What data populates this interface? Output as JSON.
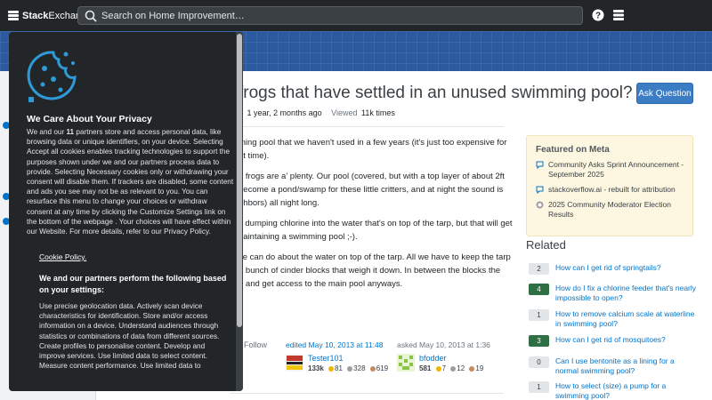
{
  "topbar": {
    "brand_a": "Stack",
    "brand_b": "Exchange",
    "search_placeholder": "Search on Home Improvement…",
    "icons": [
      "search-icon",
      "help-icon",
      "site-switcher-icon"
    ]
  },
  "question": {
    "title": "frogs that have settled in an unused swimming pool?",
    "ask_button": "Ask Question",
    "meta_partial": "d",
    "meta_modified": "1 year, 2 months ago",
    "meta_viewed_label": "Viewed",
    "meta_viewed": "11k times",
    "body": [
      [
        "ming pool that we haven't used in a few years (it's just too expensive for",
        "nt time)."
      ],
      [
        "e frogs are a' plenty. Our pool (covered, but with a top layer of about 2ft",
        "become a pond/swamp for these little critters, and at night the sound is",
        "ghbors) all night long."
      ],
      [
        "y dumping chlorine into the water that's on top of the tarp, but that will get",
        "naintaining a swimming pool ;-)."
      ],
      [
        "ve can do about the water on top of the tarp. All we have to keep the tarp",
        "a bunch of cinder blocks that weigh it down. In between the blocks the",
        "p and get access to the main pool anyways."
      ]
    ],
    "follow": "Follow",
    "edited": {
      "label": "edited May 10, 2013 at 11:48",
      "user": "Tester101",
      "rep": "133k",
      "gold": "81",
      "silver": "328",
      "bronze": "619"
    },
    "asked": {
      "label": "asked May 10, 2013 at 1:36",
      "user": "bfodder",
      "rep": "581",
      "gold": "7",
      "silver": "12",
      "bronze": "19"
    }
  },
  "meta": {
    "heading": "Featured on Meta",
    "items": [
      {
        "icon": "chat-bubble-icon",
        "text": "Community Asks Sprint Announcement - September 2025"
      },
      {
        "icon": "chat-bubble-icon",
        "text": "stackoverflow.ai - rebuilt for attribution"
      },
      {
        "icon": "stackexchange-meta-icon",
        "text": "2025 Community Moderator Election Results"
      }
    ]
  },
  "related": {
    "heading": "Related",
    "items": [
      {
        "count": "2",
        "accepted": false,
        "text": "How can I get rid of springtails?"
      },
      {
        "count": "4",
        "accepted": true,
        "text": "How do I fix a chlorine feeder that's nearly impossible to open?"
      },
      {
        "count": "1",
        "accepted": false,
        "text": "How to remove calcium scale at waterline in swimming pool?"
      },
      {
        "count": "3",
        "accepted": true,
        "text": "How can I get rid of mosquitoes?"
      },
      {
        "count": "0",
        "accepted": false,
        "text": "Can I use bentonite as a lining for a normal swimming pool?"
      },
      {
        "count": "1",
        "accepted": false,
        "text": "How to select (size) a pump for a swimming pool?"
      }
    ]
  },
  "cookie": {
    "title": "We Care About Your Privacy",
    "intro_pre": "We and our ",
    "intro_count": "11",
    "intro_post": " partners store and access personal data, like browsing data or unique identifiers, on your device. Selecting Accept all cookies enables tracking technologies to support the purposes shown under we and our partners process data to provide. Selecting Necessary cookies only or withdrawing your consent will disable them. If trackers are disabled, some content and ads you see may not be as relevant to you. You can resurface this menu to change your choices or withdraw consent at any time by clicking the Customize Settings link on the bottom of the webpage . Your choices will have effect within our Website. For more details, refer to our Privacy Policy.",
    "policy_link": "Cookie Policy.",
    "subheading": "We and our partners perform the following based on your settings:",
    "purposes": "Use precise geolocation data. Actively scan device characteristics for identification. Store and/or access information on a device. Understand audiences through statistics or combinations of data from different sources. Create profiles to personalise content. Develop and improve services. Use limited data to select content. Measure content performance. Use limited data to",
    "icon": "cookie-icon"
  },
  "colors": {
    "topbar": "#232629",
    "banner": "#2c5aa0",
    "link": "#0074cc",
    "accepted": "#2f6f44",
    "meta_bg": "#fdf7e2",
    "modal": "#232629"
  }
}
